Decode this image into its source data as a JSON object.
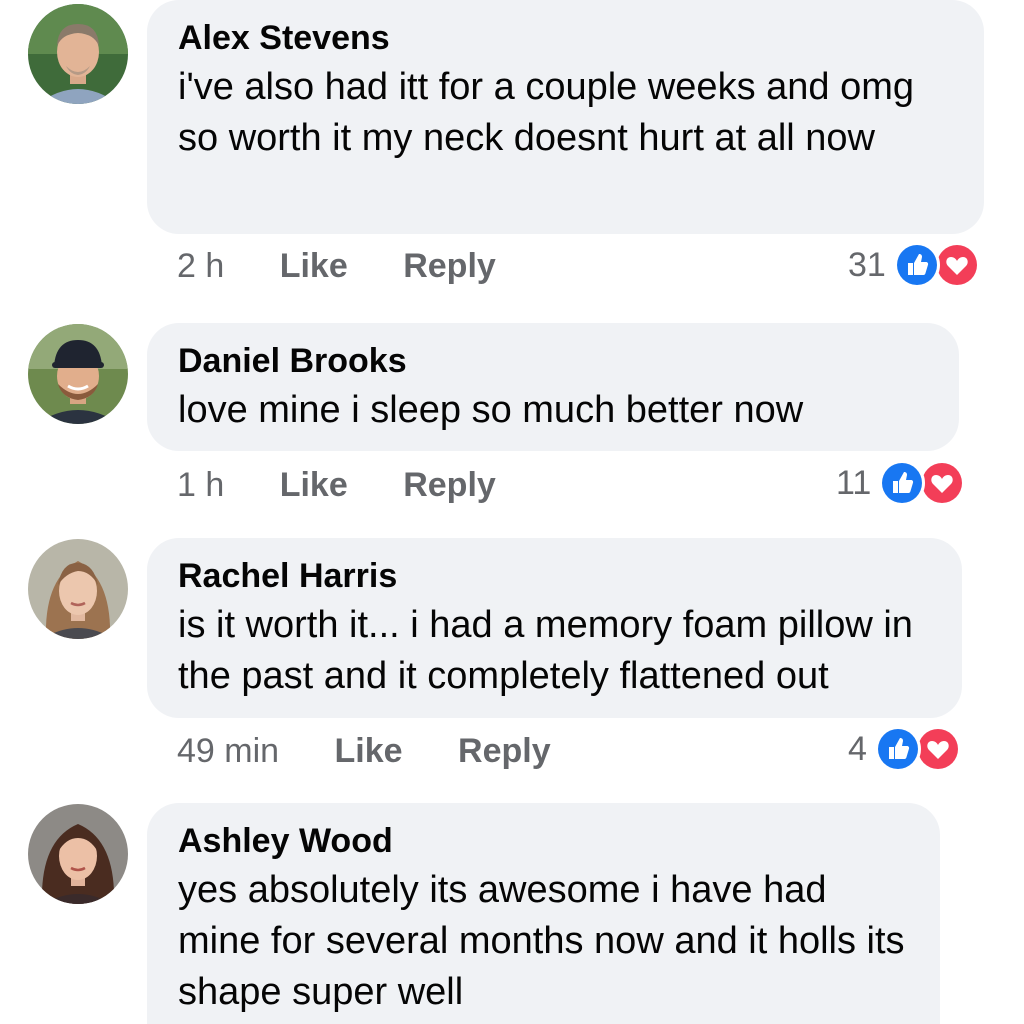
{
  "comments": [
    {
      "author": "Alex Stevens",
      "text": "i've also had itt for a couple weeks and omg so worth it my neck doesnt hurt at all now",
      "time": "2 h",
      "like_label": "Like",
      "reply_label": "Reply",
      "reaction_count": "31",
      "reactions": [
        "like-icon",
        "love-icon"
      ]
    },
    {
      "author": "Daniel Brooks",
      "text": "love mine i sleep so much  better now",
      "time": "1 h",
      "like_label": "Like",
      "reply_label": "Reply",
      "reaction_count": "11",
      "reactions": [
        "like-icon",
        "love-icon"
      ]
    },
    {
      "author": "Rachel Harris",
      "text": "is it worth it... i had a memory foam pillow in the past and it completely flattened out",
      "time": "49 min",
      "like_label": "Like",
      "reply_label": "Reply",
      "reaction_count": "4",
      "reactions": [
        "like-icon",
        "love-icon"
      ]
    },
    {
      "author": "Ashley Wood",
      "text": "yes absolutely its awesome i have had mine for several months now and it holls its shape super well"
    }
  ],
  "colors": {
    "bubble": "#f0f2f5",
    "like_blue": "#1877f2",
    "love_red": "#f33e58",
    "meta_gray": "#65676b"
  }
}
